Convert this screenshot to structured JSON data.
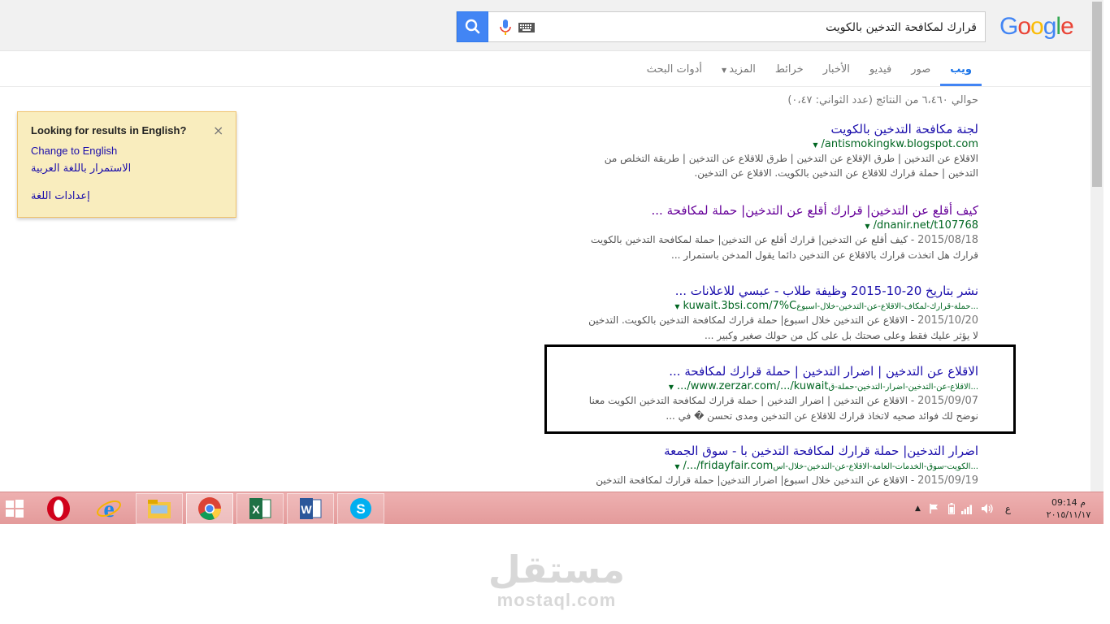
{
  "header": {
    "logo_text": [
      "G",
      "o",
      "o",
      "g",
      "l",
      "e"
    ],
    "search_value": "قرارك لمكافحة التدخين بالكويت"
  },
  "tabs": [
    {
      "label": "ويب",
      "active": true
    },
    {
      "label": "صور"
    },
    {
      "label": "فيديو"
    },
    {
      "label": "الأخبار"
    },
    {
      "label": "خرائط"
    },
    {
      "label": "المزيد",
      "dropdown": true
    },
    {
      "label": "أدوات البحث"
    }
  ],
  "stats": "حوالي ٦،٤٦٠ من النتائج (عدد الثواني: ٠،٤٧)",
  "lang_panel": {
    "heading": "Looking for results in English?",
    "close": "×",
    "change": "Change to English",
    "continue": "الاستمرار باللغة العربية",
    "settings": "إعدادات اللغة"
  },
  "results": [
    {
      "title": "لجنة مكافحة التدخين بالكويت",
      "url_pre": "antismoking",
      "url_bold": "",
      "url": "antismokingkw.blogspot.com/",
      "line1": "الاقلاع عن التدخين | طرق الإقلاع عن التدخين | طرق للاقلاع عن التدخين | طريقة التخلص من",
      "line2": "التدخين | حملة قرارك للاقلاع عن التدخين بالكويت. الاقلاع عن التدخين."
    },
    {
      "title": "كيف أقلع عن التدخين| قرارك أقلع عن التدخين| حملة لمكافحة ...",
      "url": "dnanir.net/t107768/",
      "date": "2015/08/18",
      "line1": "- كيف أقلع عن التدخين| قرارك أقلع عن التدخين| حملة لمكافحة التدخين بالكويت",
      "line2": "قرارك هل اتخذت قرارك بالاقلاع عن التدخين دائما يقول المدخن باستمرار ..."
    },
    {
      "title": "نشر بتاريخ 20-10-2015 وظيفة طلاب - عبسي للاعلانات ...",
      "url": "kuwait.3bsi.com/7%C",
      "url_tail": "...حملة-قرارك-لمكاف-الاقلاع-عن-التدخين-خلال-اسبوع",
      "date": "2015/10/20",
      "line1": "- الاقلاع عن التدخين خلال اسبوع| حملة قرارك لمكافحة التدخين بالكويت. التدخين",
      "line2": "لا يؤثر عليك فقط وعلى صحتك بل على كل من حولك صغير وكبير ..."
    },
    {
      "title": "الاقلاع عن التدخين | اضرار التدخين | حملة قرارك لمكافحة ...",
      "url": "www.zerzar.com/.../kuwait/...",
      "url_tail": "...الاقلاع-عن-التدخين-اضرار-التدخين-حملة-ق",
      "date": "2015/09/07",
      "line1": "- الاقلاع عن التدخين | اضرار التدخين | حملة قرارك لمكافحة التدخين الكويت معنا",
      "line2": "نوضح لك فوائد صحيه لاتخاذ قرارك للاقلاع عن التدخين ومدى تحسن � في ..."
    },
    {
      "title": "اضرار التدخين| حملة قرارك لمكافحة التدخين با - سوق الجمعة",
      "url": "fridayfair.com/.../",
      "url_tail": "...الكويت-سوق-الخدمات-العامة-الاقلاع-عن-التدخين-خلال-اس",
      "date": "2015/09/19",
      "line1": "- الاقلاع عن التدخين خلال اسبوع| اضرار التدخين| حملة قرارك لمكافحة التدخين"
    }
  ],
  "taskbar": {
    "apps": [
      "windows-start",
      "opera",
      "internet-explorer",
      "file-explorer",
      "chrome",
      "excel",
      "word",
      "skype"
    ],
    "lang": "ع",
    "time": "09:14 م",
    "date": "٢٠١٥/١١/١٧"
  },
  "watermark": {
    "arabic": "مستقل",
    "latin": "mostaql.com"
  }
}
